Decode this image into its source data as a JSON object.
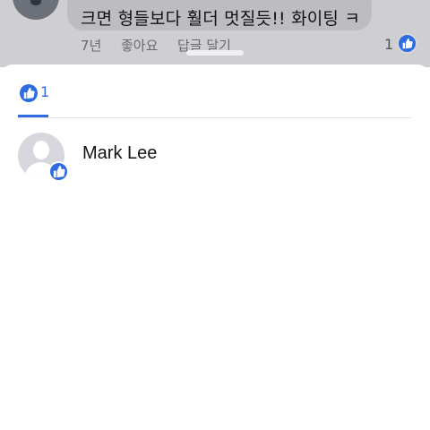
{
  "comment": {
    "text": "크면 형들보다 훨더 멋질듯!!  화이팅 ㅋ",
    "time": "7년",
    "like_label": "좋아요",
    "reply_label": "답글 달기",
    "reaction_count": "1"
  },
  "reactions_sheet": {
    "tabs": [
      {
        "icon": "thumbs-up-icon",
        "count": "1"
      }
    ],
    "people": [
      {
        "name": "Mark Lee",
        "reaction": "thumbs-up-icon"
      }
    ]
  },
  "colors": {
    "accent": "#2f6ce2",
    "backdrop": "#cfcfd2"
  }
}
